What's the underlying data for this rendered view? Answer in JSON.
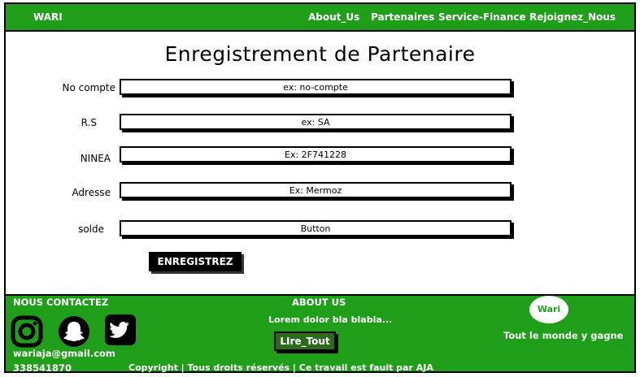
{
  "navbar": {
    "brand": "WARI",
    "links": [
      "About_Us",
      "Partenaires",
      "Service-Finance",
      "Rejoignez_Nous"
    ]
  },
  "page_title": "Enregistrement de Partenaire",
  "form": {
    "fields": [
      {
        "label": "No compte",
        "placeholder": "ex: no-compte"
      },
      {
        "label": "R.S",
        "placeholder": "ex: SA"
      },
      {
        "label": "NINEA",
        "placeholder": "Ex: 2F741228"
      },
      {
        "label": "Adresse",
        "placeholder": "Ex: Mermoz"
      },
      {
        "label": "solde",
        "placeholder": "Button"
      }
    ],
    "submit_label": "ENREGISTREZ"
  },
  "footer": {
    "contact_heading": "NOUS CONTACTEZ",
    "email": "wariaja@gmail.com",
    "phone": "338541870",
    "about_heading": "ABOUT US",
    "about_text": "Lorem dolor bla blabla...",
    "read_all_label": "LIre_Tout",
    "logo_text": "Wari",
    "tagline": "Tout le monde y gagne",
    "copyright": "Copyright | Tous droits réservés | Ce travail est fauit par AJA",
    "social_icons": [
      "instagram-icon",
      "snapchat-icon",
      "twitter-icon"
    ]
  },
  "colors": {
    "brand_green": "#1f9e1a",
    "button_dark_green": "#2d6a1e",
    "button_black": "#000000"
  }
}
